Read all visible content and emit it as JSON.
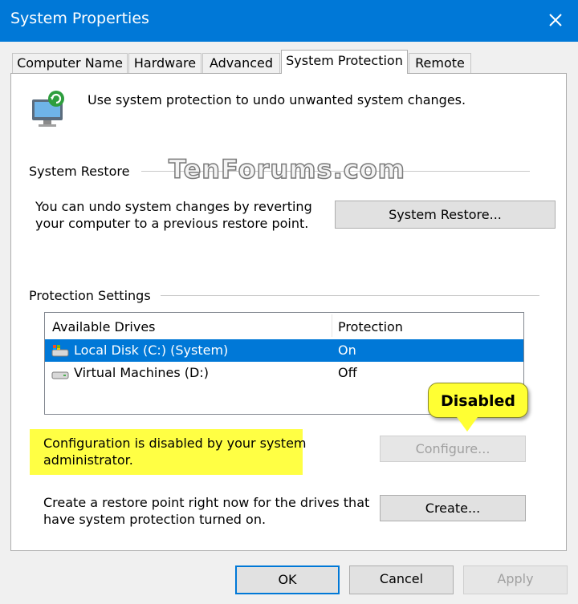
{
  "window": {
    "title": "System Properties",
    "close_icon": "close-icon"
  },
  "tabs": [
    {
      "label": "Computer Name",
      "active": false
    },
    {
      "label": "Hardware",
      "active": false
    },
    {
      "label": "Advanced",
      "active": false
    },
    {
      "label": "System Protection",
      "active": true
    },
    {
      "label": "Remote",
      "active": false
    }
  ],
  "intro": {
    "text": "Use system protection to undo unwanted system changes.",
    "icon": "system-protection-icon"
  },
  "watermark": "TenForums.com",
  "system_restore": {
    "label": "System Restore",
    "description_line1": "You can undo system changes by reverting",
    "description_line2": "your computer to a previous restore point.",
    "button_label": "System Restore...",
    "button_mnemonic": "S"
  },
  "protection_settings": {
    "label": "Protection Settings",
    "columns": [
      "Available Drives",
      "Protection"
    ],
    "drives": [
      {
        "name": "Local Disk (C:) (System)",
        "protection": "On",
        "selected": true,
        "icon": "system-drive-icon"
      },
      {
        "name": "Virtual Machines (D:)",
        "protection": "Off",
        "selected": false,
        "icon": "drive-icon"
      }
    ]
  },
  "callout": {
    "text": "Disabled",
    "color": "#ffff33"
  },
  "configure": {
    "message_line1": "Configuration is disabled by your system",
    "message_line2": "administrator.",
    "button_label": "Configure...",
    "enabled": false
  },
  "create": {
    "description_line1": "Create a restore point right now for the drives that",
    "description_line2": "have system protection turned on.",
    "button_label": "Create...",
    "button_mnemonic": "C"
  },
  "footer": {
    "ok_label": "OK",
    "cancel_label": "Cancel",
    "apply_label": "Apply",
    "apply_enabled": false
  },
  "colors": {
    "accent": "#0078d7",
    "highlight": "#ffff44"
  }
}
